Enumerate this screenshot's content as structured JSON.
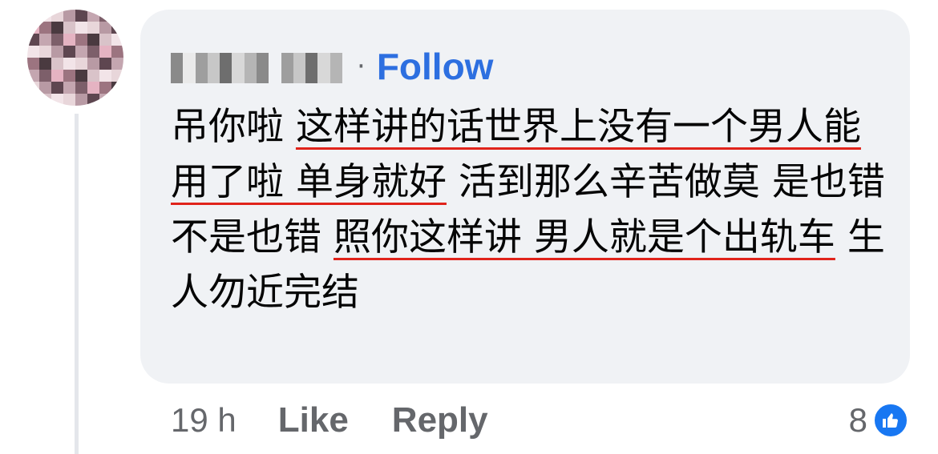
{
  "comment": {
    "author_name_blurred": "Delia Wee",
    "separator": "·",
    "follow_label": "Follow",
    "text_segments": [
      {
        "text": "吊你啦 ",
        "underlined": false
      },
      {
        "text": "这样讲的话世界上没有一个男人能用了啦 单身就好",
        "underlined": true
      },
      {
        "text": " 活到那么辛苦做莫 是也错不是也错 ",
        "underlined": false
      },
      {
        "text": "照你这样讲 男人就是个出轨车",
        "underlined": true
      },
      {
        "text": " 生人勿近完结",
        "underlined": false
      }
    ],
    "timestamp": "19 h",
    "like_label": "Like",
    "reply_label": "Reply",
    "reaction_count": "8",
    "reaction_icon": "thumbs-up-icon"
  },
  "colors": {
    "bubble_bg": "#f0f2f5",
    "follow_blue": "#2d6fe0",
    "underline_red": "#e0231b",
    "meta_gray": "#65676b",
    "like_blue": "#1877f2"
  }
}
